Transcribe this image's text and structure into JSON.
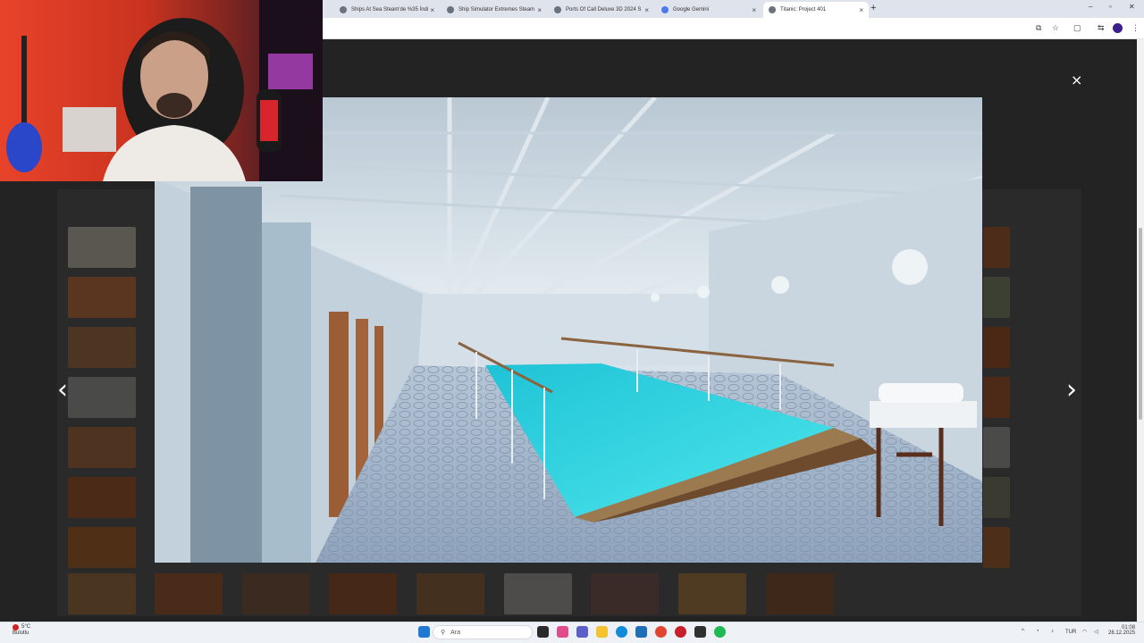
{
  "browser": {
    "tabs": [
      {
        "title": "Ships At Sea Steam'de %35 İndi",
        "active": false
      },
      {
        "title": "Ship Simulator Extremes Steam",
        "active": false
      },
      {
        "title": "Ports Of Call Deluxe 3D 2024 S",
        "active": false
      },
      {
        "title": "Google Gemini",
        "active": false
      },
      {
        "title": "Titanic: Project 401",
        "active": true
      }
    ],
    "new_tab_label": "+",
    "window_controls": [
      "–",
      "▫",
      "✕"
    ]
  },
  "lightbox": {
    "close_label": "×",
    "prev_label": "‹",
    "next_label": "›",
    "image_description_icon": "pool-screenshot"
  },
  "taskbar": {
    "weather_temp": "5°C",
    "weather_text": "Bulutlu",
    "search_placeholder": "Ara",
    "language": "TUR",
    "time": "01:08",
    "date": "28.12.2025"
  },
  "colors": {
    "page_bg": "#232323",
    "pool_water": "#35d6e0",
    "accent_profile": "#3c1e8c"
  }
}
